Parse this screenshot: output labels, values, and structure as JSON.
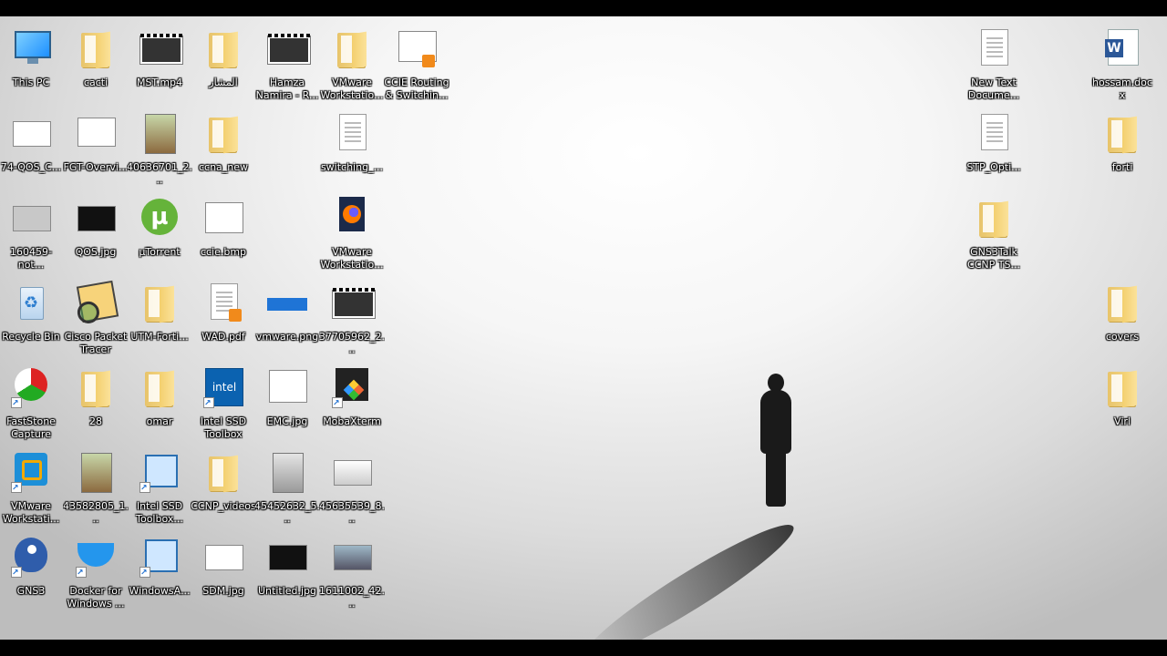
{
  "icons": {
    "this_pc": "This PC",
    "cacti": "cacti",
    "mst_mp4": "MST.mp4",
    "arabic_folder": "المشار",
    "hamza_namira": "Hamza Namira - R...",
    "vmware_ws_1": "VMware Workstatio...",
    "ccie_routing": "CCIE Routing & Switchin...",
    "qos_74": "74-QOS_C...",
    "fgt_overview": "FGT-Overvi...",
    "img_40636701": "40636701_2...",
    "ccna_new": "ccna_new",
    "switching": "switching_...",
    "notes_160459": "160459-not...",
    "qos_jpg": "QOS.jpg",
    "utorrent": "µTorrent",
    "ccie_bmp": "ccie.bmp",
    "vmware_ws_2": "VMware Workstatio...",
    "recycle_bin": "Recycle Bin",
    "cisco_packet_tracer": "Cisco Packet Tracer",
    "utm_forti": "UTM-Forti...",
    "wad_pdf": "WAD.pdf",
    "vmware_png": "vmware.png",
    "img_37705962": "37705962_2...",
    "faststone_capture": "FastStone Capture",
    "folder_28": "28",
    "omar": "omar",
    "intel_ssd_toolbox": "Intel SSD Toolbox",
    "emc_jpg": "EMC.jpg",
    "mobaxterm": "MobaXterm",
    "vmware_workstati": "VMware Workstati...",
    "img_43582805": "43582805_1...",
    "intel_ssd_toolbox_2": "Intel SSD Toolbox...",
    "ccnp_videos": "CCNP_videos",
    "img_45452632": "45452632_5...",
    "img_45635539": "45635539_8...",
    "gns3": "GNS3",
    "docker": "Docker for Windows ...",
    "windowsa": "WindowsA...",
    "sdm_jpg": "SDM.jpg",
    "untitled_jpg": "Untitled.jpg",
    "img_1611002": "1611002_42...",
    "new_text_doc": "New Text Docume...",
    "hossam_docx": "hossam.docx",
    "stp_opti": "STP_Opti...",
    "forti": "forti",
    "gns3talk": "GNS3Talk CCNP TS...",
    "covers": "covers",
    "virl": "Virl"
  },
  "icon_kinds": {
    "pc": "monitor-icon",
    "folder": "folder-icon",
    "video": "video-file-icon",
    "image": "image-file-icon",
    "document": "document-icon",
    "recycle": "recycle-bin-icon"
  },
  "colors": {
    "label_text": "#ffffff",
    "frame_bars": "#000000",
    "wallpaper_light": "#f6f6f6",
    "wallpaper_dark": "#bdbdbd"
  }
}
